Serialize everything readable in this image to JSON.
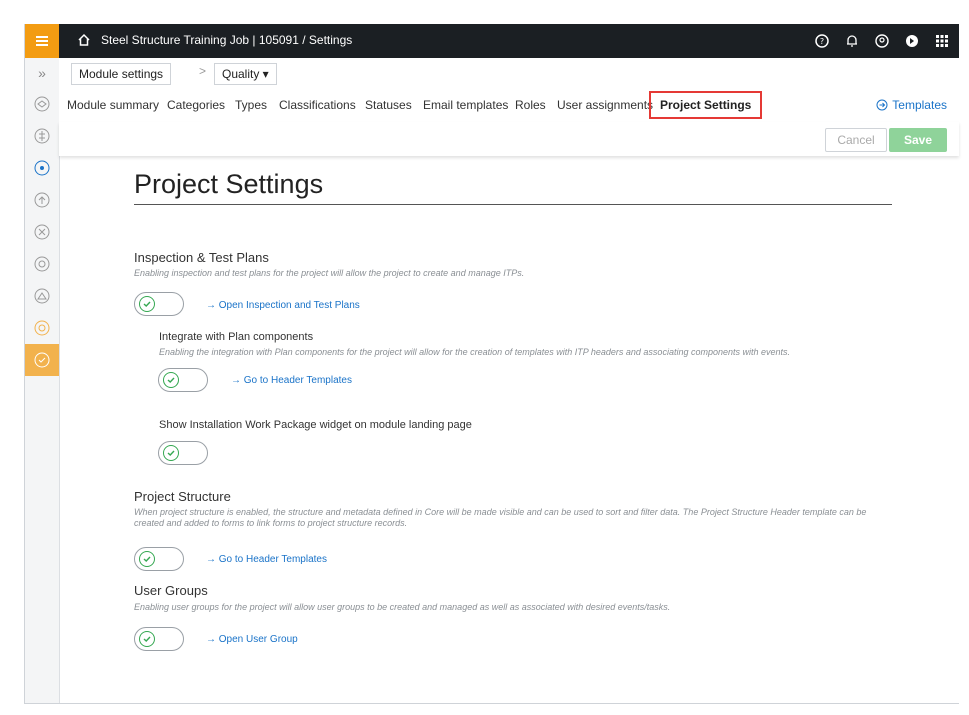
{
  "topbar": {
    "title": "Steel Structure Training Job | 105091  /  Settings",
    "icons": [
      "help-icon",
      "bell-icon",
      "user-icon",
      "exit-icon",
      "apps-grid-icon"
    ]
  },
  "breadcrumb": {
    "module_settings": "Module settings",
    "separator": ">",
    "quality": "Quality ▾"
  },
  "tabs": [
    {
      "label": "Module summary"
    },
    {
      "label": "Categories"
    },
    {
      "label": "Types"
    },
    {
      "label": "Classifications"
    },
    {
      "label": "Statuses"
    },
    {
      "label": "Email templates"
    },
    {
      "label": "Roles"
    },
    {
      "label": "User assignments"
    },
    {
      "label": "Project Settings",
      "active": true
    }
  ],
  "templates_link": "Templates",
  "actions": {
    "cancel": "Cancel",
    "save": "Save"
  },
  "page": {
    "title": "Project Settings",
    "itp": {
      "title": "Inspection & Test Plans",
      "desc": "Enabling inspection and test plans for the project will allow the project to create and manage ITPs.",
      "link": "→ Open Inspection and Test Plans"
    },
    "plan": {
      "title": "Integrate with Plan components",
      "desc": "Enabling the integration with Plan components for the project will allow for the creation of templates with ITP headers and associating components with events.",
      "link": "→ Go to Header Templates"
    },
    "iwp": {
      "title": "Show Installation Work Package widget on module landing page"
    },
    "structure": {
      "title": "Project Structure",
      "desc": "When project structure is enabled, the structure and metadata defined in Core will be made visible and can be used to sort and filter data. The Project Structure Header template can be created and added to forms to link forms to project structure records.",
      "link": "→ Go to Header Templates"
    },
    "groups": {
      "title": "User Groups",
      "desc": "Enabling user groups for the project will allow user groups to be created and managed as well as associated with desired events/tasks.",
      "link": "→ Open User Group"
    }
  },
  "colors": {
    "accent": "#f39c12",
    "topbar": "#1b1f23",
    "link": "#1a73c8",
    "save": "#8fd39a",
    "toggle_on": "#36a852",
    "highlight": "#e53935"
  }
}
